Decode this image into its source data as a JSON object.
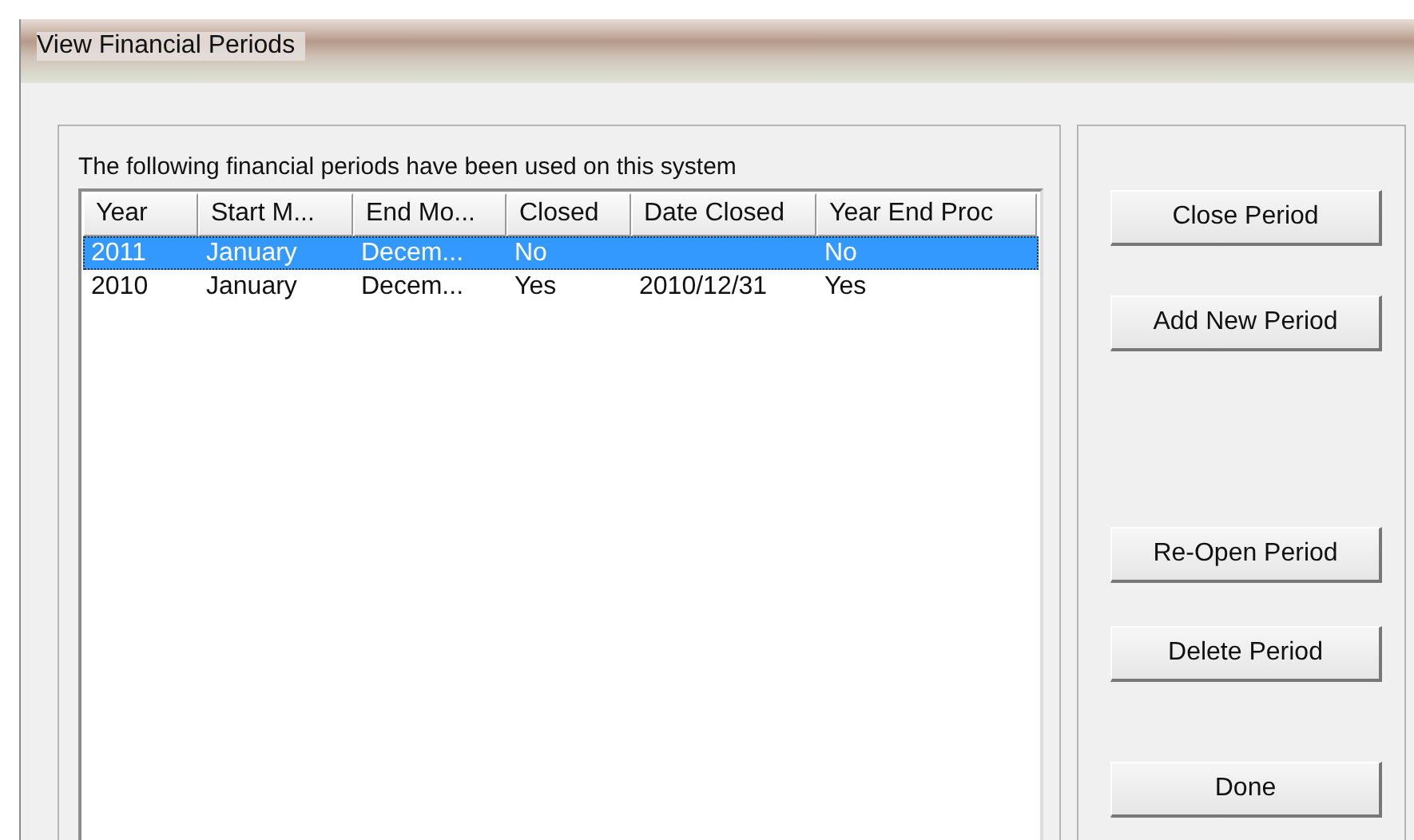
{
  "window": {
    "title": "View Financial Periods"
  },
  "caption": "The following financial periods have been used on this system",
  "table": {
    "columns": [
      "Year",
      "Start M...",
      "End Mo...",
      "Closed",
      "Date Closed",
      "Year End Proc"
    ],
    "rows": [
      {
        "cells": [
          "2011",
          "January",
          "Decem...",
          "No",
          "",
          "No"
        ],
        "selected": true
      },
      {
        "cells": [
          "2010",
          "January",
          "Decem...",
          "Yes",
          "2010/12/31",
          "Yes"
        ],
        "selected": false
      }
    ]
  },
  "button_groups": [
    [
      "Close Period",
      "Add New Period"
    ],
    [
      "Re-Open Period",
      "Delete Period"
    ],
    [
      "Done"
    ]
  ]
}
